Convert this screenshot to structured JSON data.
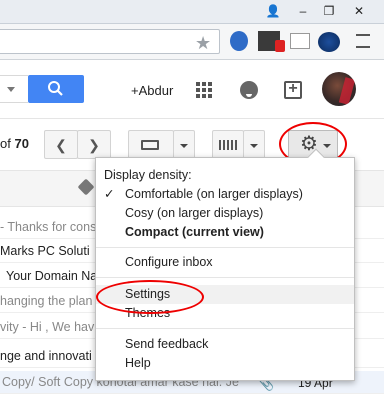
{
  "header": {
    "account_label": "+Abdur"
  },
  "toolbar": {
    "pager_of": "of",
    "pager_total": "70"
  },
  "emails": [
    {
      "text": "- Thanks for cons",
      "muted": true
    },
    {
      "text": "Marks PC Soluti",
      "muted": false
    },
    {
      "text": "Your Domain Na",
      "muted": false
    },
    {
      "text": "hanging the plan",
      "muted": true
    },
    {
      "text": "vity - Hi , We hav",
      "muted": true
    },
    {
      "text": "nge and innovati",
      "muted": false
    },
    {
      "text": "Copy/ Soft Copy kohotal amar kase hai. Je",
      "muted": true,
      "date": "19 Apr"
    }
  ],
  "menu": {
    "density_heading": "Display density:",
    "comfortable": "Comfortable (on larger displays)",
    "cosy": "Cosy (on larger displays)",
    "compact": "Compact (current view)",
    "configure_inbox": "Configure inbox",
    "settings": "Settings",
    "themes": "Themes",
    "send_feedback": "Send feedback",
    "help": "Help"
  },
  "icons": {
    "star": "star-icon",
    "apps": "apps-grid-icon",
    "notifications": "bell-icon",
    "share": "share-icon",
    "gear": "gear-icon",
    "tag": "label-icon",
    "attachment": "paperclip-icon"
  },
  "colors": {
    "search_button": "#4285f4",
    "highlight_ring": "#ee0000"
  }
}
